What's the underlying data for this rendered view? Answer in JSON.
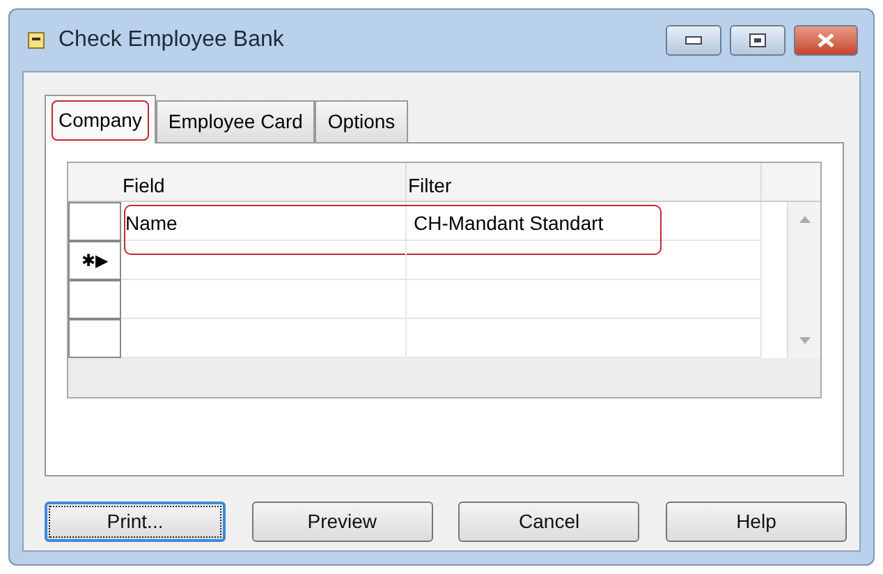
{
  "window": {
    "title": "Check Employee Bank"
  },
  "tabs": [
    {
      "label": "Company",
      "selected": true,
      "highlighted": true
    },
    {
      "label": "Employee Card",
      "selected": false,
      "highlighted": false
    },
    {
      "label": "Options",
      "selected": false,
      "highlighted": false
    }
  ],
  "table": {
    "columns": [
      "Field",
      "Filter"
    ],
    "rows": [
      {
        "field": "Name",
        "filter": "CH-Mandant Standart",
        "highlighted": true
      },
      {
        "marker": "✱▶",
        "highlighted": false
      },
      {
        "highlighted": false
      },
      {
        "highlighted": false
      }
    ]
  },
  "buttons": [
    {
      "label": "Print...",
      "focused": true
    },
    {
      "label": "Preview",
      "focused": false
    },
    {
      "label": "Cancel",
      "focused": false
    },
    {
      "label": "Help",
      "focused": false
    }
  ]
}
